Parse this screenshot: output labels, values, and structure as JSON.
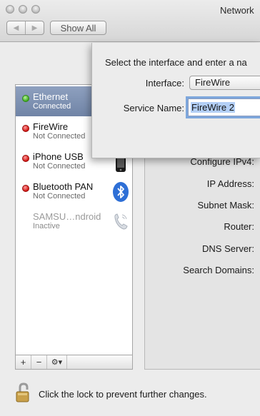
{
  "window": {
    "title": "Network"
  },
  "toolbar": {
    "back_glyph": "◀",
    "forward_glyph": "▶",
    "show_all_label": "Show All"
  },
  "services": [
    {
      "name": "Ethernet",
      "status": "Connected",
      "indicator": "green",
      "icon": "ethernet-icon",
      "selected": true
    },
    {
      "name": "FireWire",
      "status": "Not Connected",
      "indicator": "red",
      "icon": "firewire-icon"
    },
    {
      "name": "iPhone USB",
      "status": "Not Connected",
      "indicator": "red",
      "icon": "iphone-icon"
    },
    {
      "name": "Bluetooth PAN",
      "status": "Not Connected",
      "indicator": "red",
      "icon": "bluetooth-icon"
    },
    {
      "name": "SAMSU…ndroid",
      "status": "Inactive",
      "indicator": "none",
      "icon": "phone-modem-icon"
    }
  ],
  "sidebar_toolbar": {
    "add_label": "+",
    "remove_label": "−",
    "action_label": "⚙▾"
  },
  "detail": {
    "fields": [
      "Configure IPv4:",
      "IP Address:",
      "Subnet Mask:",
      "Router:",
      "DNS Server:",
      "Search Domains:"
    ]
  },
  "sheet": {
    "prompt": "Select the interface and enter a na",
    "interface_label": "Interface:",
    "interface_value": "FireWire",
    "service_name_label": "Service Name:",
    "service_name_value": "FireWire 2"
  },
  "lock": {
    "text": "Click the lock to prevent further changes."
  },
  "colors": {
    "selection": "#7d90b2",
    "status_green": "#3da81d",
    "status_red": "#d0120f",
    "focus_ring": "#7ea7dc",
    "bluetooth": "#2e6fd6"
  }
}
